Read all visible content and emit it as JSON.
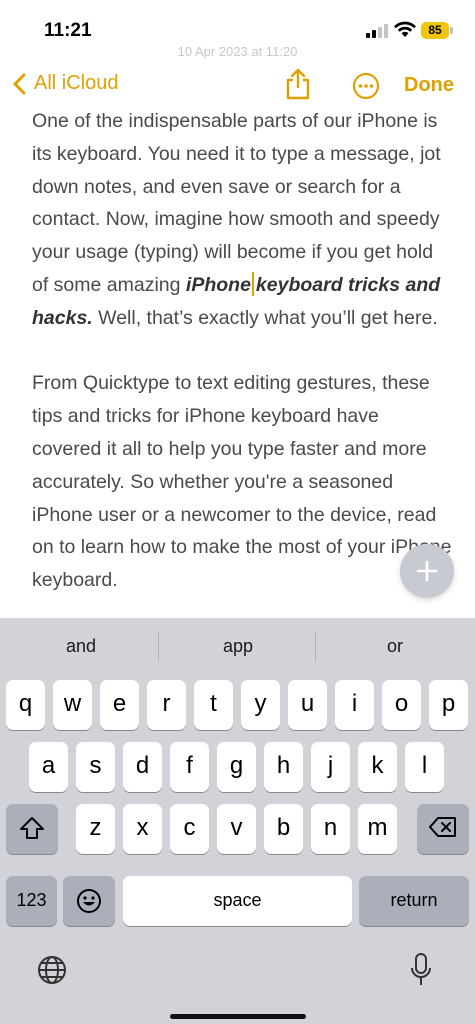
{
  "status": {
    "time": "11:21",
    "battery": "85",
    "date_faded": "10 Apr 2023 at 11:20"
  },
  "nav": {
    "back_label": "All iCloud",
    "done_label": "Done"
  },
  "note": {
    "para1_part1": "One of the indispensable parts of our iPhone is its keyboard. You need it to type a message, jot down notes, and even save or search for a contact. Now, imagine how smooth and speedy your usage (typing) will become if you get hold of some amazing ",
    "para1_bold_a": "iPhone",
    "para1_bold_b": "keyboard tricks and hacks.",
    "para1_part2": " Well, that’s exactly what you’ll get here.",
    "para2": "From Quicktype to text editing gestures, these tips and tricks for iPhone keyboard have covered it all to help you type faster and more accurately. So whether you're a seasoned iPhone user or a newcomer to the device, read on to learn how to make the most of your iPhone keyboard."
  },
  "keyboard": {
    "suggestions": [
      "and",
      "app",
      "or"
    ],
    "row1": [
      "q",
      "w",
      "e",
      "r",
      "t",
      "y",
      "u",
      "i",
      "o",
      "p"
    ],
    "row2": [
      "a",
      "s",
      "d",
      "f",
      "g",
      "h",
      "j",
      "k",
      "l"
    ],
    "row3": [
      "z",
      "x",
      "c",
      "v",
      "b",
      "n",
      "m"
    ],
    "numbers_label": "123",
    "space_label": "space",
    "return_label": "return"
  },
  "colors": {
    "accent": "#e0a100",
    "keyboard_bg": "#d1d3d9",
    "dark_key": "#abafba"
  }
}
